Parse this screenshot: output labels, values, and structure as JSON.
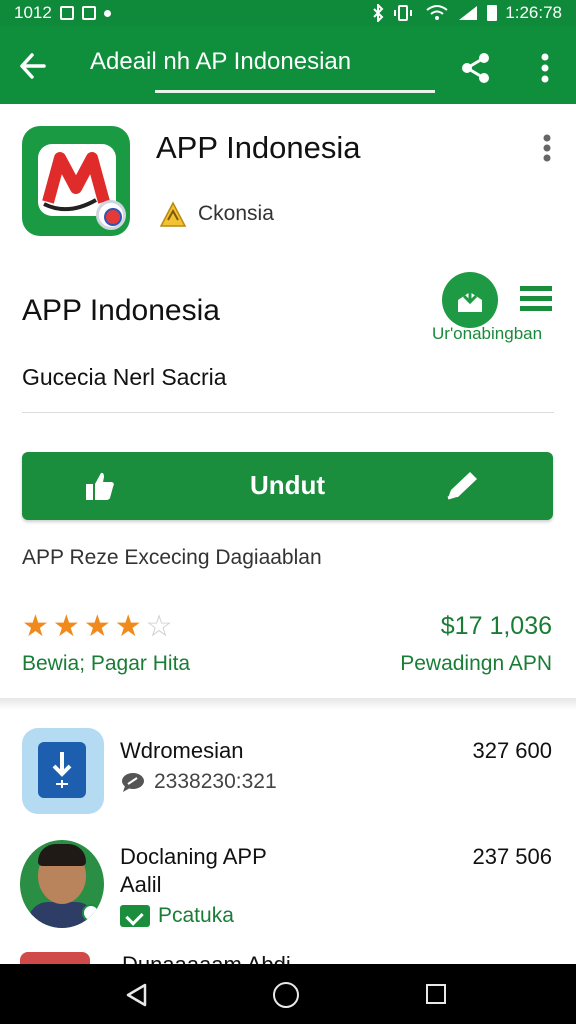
{
  "status_bar": {
    "time": "1012",
    "right_time": "1:26:78"
  },
  "app_bar": {
    "title": "Adeail nh AP Indonesian"
  },
  "header": {
    "app_name": "APP Indonesia",
    "developer": "Ckonsia"
  },
  "details": {
    "title": "APP Indonesia",
    "action_link": "Ur'onabingban",
    "subtitle": "Gucecia Nerl Sacria",
    "primary_button": "Undut",
    "description": "APP Reze Excecing Dagiaablan",
    "rating_stars": 4,
    "rating_max": 5,
    "price": "$17 1,036",
    "rating_label": "Bewia; Pagar Hita",
    "right_label": "Pewadingn APN"
  },
  "list": [
    {
      "title": "Wdromesian",
      "subtitle": "2338230:321",
      "value": "327 600",
      "icon": "download-doc-icon"
    },
    {
      "title_line1": "Doclaning APP",
      "title_line2": "Aalil",
      "subtitle": "Pcatuka",
      "value": "237 506",
      "icon": "avatar"
    },
    {
      "title": "Dunaaaaam Abdi"
    }
  ],
  "colors": {
    "primary": "#0f8f3c",
    "accent_text": "#1a7d36",
    "star": "#f08a1c",
    "star_empty": "#cccccc"
  }
}
